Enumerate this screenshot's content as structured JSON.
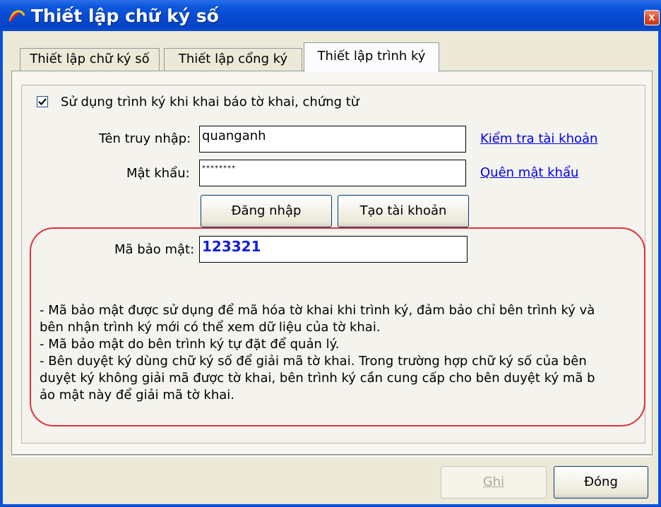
{
  "window": {
    "title": "Thiết lập chữ ký số",
    "close_label": "x"
  },
  "tabs": [
    {
      "label": "Thiết lập chữ ký số"
    },
    {
      "label": "Thiết lập cổng ký"
    },
    {
      "label": "Thiết lập trình ký"
    }
  ],
  "active_tab": "Thiết lập trình ký",
  "form": {
    "use_signer_checkbox": {
      "label": "Sử dụng trình ký khi khai báo tờ khai, chứng từ",
      "checked": true
    },
    "username": {
      "label": "Tên truy nhập:",
      "value": "quanganh"
    },
    "password": {
      "label": "Mật khẩu:",
      "value": "********"
    },
    "check_account_link": "Kiểm tra tài khoản",
    "forgot_password_link": "Quên mật khẩu",
    "login_button": "Đăng nhập",
    "create_account_button": "Tạo tài khoản",
    "security_code": {
      "label": "Mã bảo mật:",
      "value": "123321"
    }
  },
  "notes": [
    "- Mã bảo mật được sử dụng để mã hóa tờ khai khi trình ký, đảm bảo chỉ bên trình ký và",
    "bên nhận trình ký mới có thể xem dữ liệu của tờ khai.",
    "- Mã bảo mật do bên trình ký tự đặt để quản lý.",
    "- Bên duyệt ký dùng chữ ký số để giải mã tờ khai. Trong trường hợp chữ ký số của bên",
    "duyệt ký không giải mã được tờ khai, bên trình ký cần cung cấp cho bên duyệt ký mã b",
    "ảo mật này để giải mã tờ khai."
  ],
  "footer": {
    "save_button": {
      "label": "Ghi",
      "enabled": false
    },
    "close_button": {
      "label": "Đóng",
      "enabled": true
    }
  },
  "colors": {
    "titlebar": "#0a53d6",
    "window_bg": "#ece9d8",
    "link": "#0000ee",
    "highlight_border": "#e0323c",
    "security_code_text": "#1020d8"
  },
  "icons": {
    "title_icon": "app-logo-icon",
    "close": "close-icon",
    "checkbox": "checkmark-icon"
  }
}
